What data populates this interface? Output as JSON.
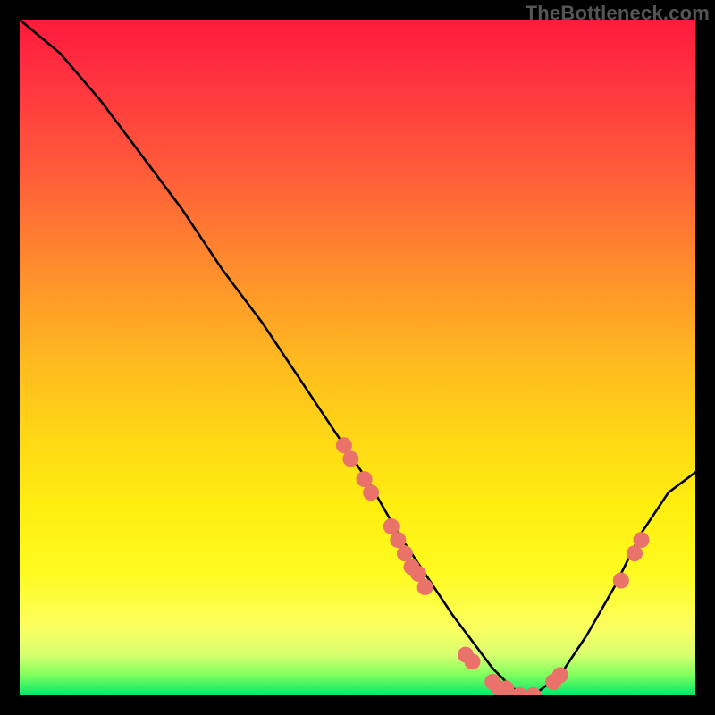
{
  "watermark": "TheBottleneck.com",
  "chart_data": {
    "type": "line",
    "title": "",
    "xlabel": "",
    "ylabel": "",
    "xlim": [
      0,
      100
    ],
    "ylim": [
      0,
      100
    ],
    "grid": false,
    "legend": false,
    "series": [
      {
        "name": "curve",
        "x": [
          0,
          6,
          12,
          18,
          24,
          30,
          36,
          42,
          48,
          52,
          56,
          60,
          64,
          67,
          70,
          73,
          76,
          80,
          84,
          88,
          92,
          96,
          100
        ],
        "y": [
          100,
          95,
          88,
          80,
          72,
          63,
          55,
          46,
          37,
          31,
          24,
          18,
          12,
          8,
          4,
          1,
          0,
          3,
          9,
          16,
          24,
          30,
          33
        ]
      }
    ],
    "scatter": [
      {
        "x": 48,
        "y": 37
      },
      {
        "x": 49,
        "y": 35
      },
      {
        "x": 51,
        "y": 32
      },
      {
        "x": 52,
        "y": 30
      },
      {
        "x": 55,
        "y": 25
      },
      {
        "x": 56,
        "y": 23
      },
      {
        "x": 57,
        "y": 21
      },
      {
        "x": 58,
        "y": 19
      },
      {
        "x": 59,
        "y": 18
      },
      {
        "x": 60,
        "y": 16
      },
      {
        "x": 66,
        "y": 6
      },
      {
        "x": 67,
        "y": 5
      },
      {
        "x": 70,
        "y": 2
      },
      {
        "x": 71,
        "y": 1
      },
      {
        "x": 72,
        "y": 1
      },
      {
        "x": 74,
        "y": 0
      },
      {
        "x": 76,
        "y": 0
      },
      {
        "x": 79,
        "y": 2
      },
      {
        "x": 80,
        "y": 3
      },
      {
        "x": 89,
        "y": 17
      },
      {
        "x": 91,
        "y": 21
      },
      {
        "x": 92,
        "y": 23
      }
    ],
    "colors": {
      "curve": "#000000",
      "points": "#e9736b"
    }
  }
}
